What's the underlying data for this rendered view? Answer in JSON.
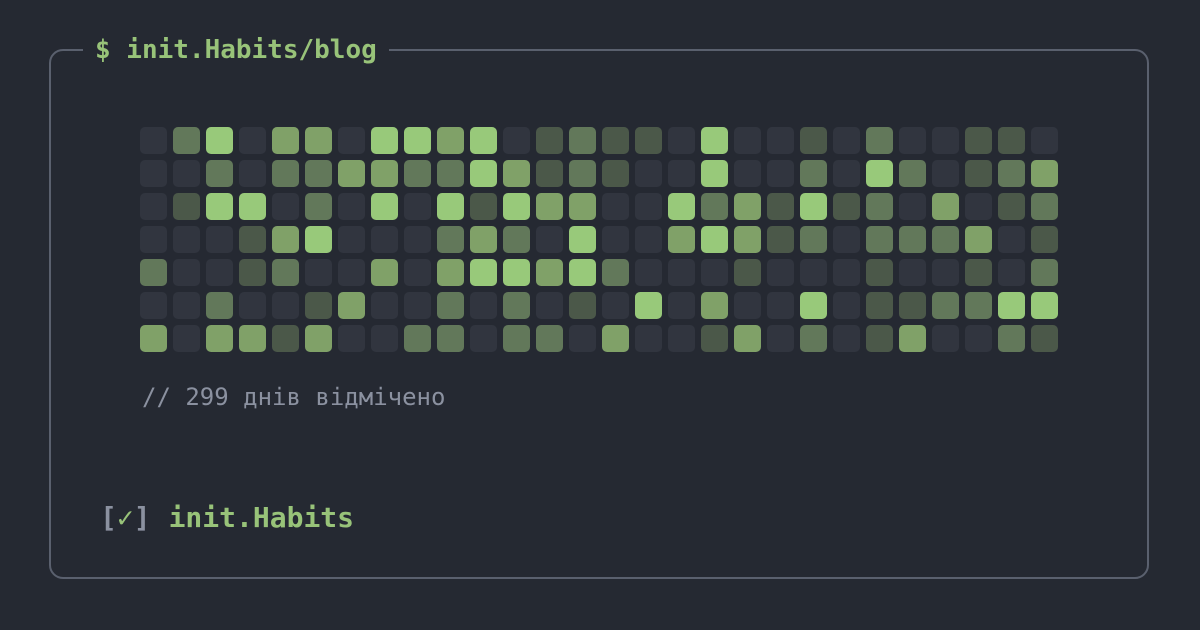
{
  "frame": {
    "title": "$ init.Habits/blog"
  },
  "habit_grid": {
    "rows": 7,
    "columns": 28,
    "level_colors": [
      "#31353f",
      "#4b5849",
      "#62785a",
      "#80a168",
      "#98c97a"
    ],
    "levels_by_row": [
      [
        0,
        2,
        4,
        0,
        3,
        3,
        0,
        4,
        4,
        3,
        4,
        0,
        1,
        2,
        1,
        1,
        0,
        4,
        0,
        0,
        1,
        0,
        2,
        0,
        0,
        1,
        1,
        0
      ],
      [
        0,
        0,
        2,
        0,
        2,
        2,
        3,
        3,
        2,
        2,
        4,
        3,
        1,
        2,
        1,
        0,
        0,
        4,
        0,
        0,
        2,
        0,
        4,
        2,
        0,
        1,
        2,
        3
      ],
      [
        0,
        1,
        4,
        4,
        0,
        2,
        0,
        4,
        0,
        4,
        1,
        4,
        3,
        3,
        0,
        0,
        4,
        2,
        3,
        1,
        4,
        1,
        2,
        0,
        3,
        0,
        1,
        2
      ],
      [
        0,
        0,
        0,
        1,
        3,
        4,
        0,
        0,
        0,
        2,
        3,
        2,
        0,
        4,
        0,
        0,
        3,
        4,
        3,
        1,
        2,
        0,
        2,
        2,
        2,
        3,
        0,
        1
      ],
      [
        2,
        0,
        0,
        1,
        2,
        0,
        0,
        3,
        0,
        3,
        4,
        4,
        3,
        4,
        2,
        0,
        0,
        0,
        1,
        0,
        0,
        0,
        1,
        0,
        0,
        1,
        0,
        2
      ],
      [
        0,
        0,
        2,
        0,
        0,
        1,
        3,
        0,
        0,
        2,
        0,
        2,
        0,
        1,
        0,
        4,
        0,
        3,
        0,
        0,
        4,
        0,
        1,
        1,
        2,
        2,
        4,
        4
      ],
      [
        3,
        0,
        3,
        3,
        1,
        3,
        0,
        0,
        2,
        2,
        0,
        2,
        2,
        0,
        3,
        0,
        0,
        1,
        3,
        0,
        2,
        0,
        1,
        3,
        0,
        0,
        2,
        1
      ]
    ]
  },
  "count_note": "// 299 днів відмічено",
  "footer": {
    "bracket_open": "[",
    "check": "✓",
    "bracket_close": "]",
    "brand": "init.Habits"
  }
}
